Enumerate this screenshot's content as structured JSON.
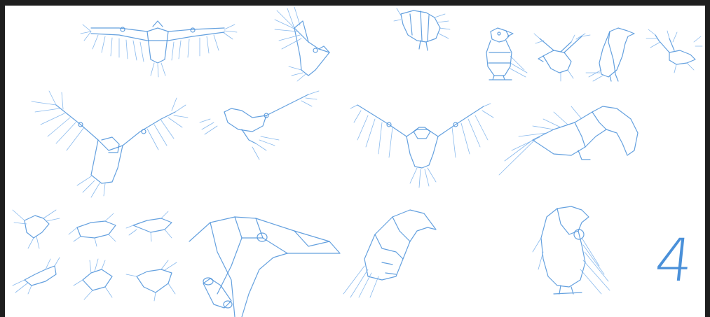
{
  "sheet": {
    "background_color": "#ffffff",
    "frame_color": "#1e1e1e",
    "ink_color": "#4a90d9",
    "page_number": "4"
  },
  "sketches": [
    {
      "name": "bird-soaring-wide-wings",
      "pose": "soaring"
    },
    {
      "name": "bird-flapping-side",
      "pose": "flapping"
    },
    {
      "name": "bird-landing-small",
      "pose": "landing"
    },
    {
      "name": "bird-perched-front",
      "pose": "perched"
    },
    {
      "name": "bird-flapping-small",
      "pose": "flapping"
    },
    {
      "name": "bird-perched-side",
      "pose": "perched"
    },
    {
      "name": "bird-takeoff-small",
      "pose": "takeoff"
    },
    {
      "name": "bird-diving-wings-up",
      "pose": "diving"
    },
    {
      "name": "bird-gliding-side",
      "pose": "gliding"
    },
    {
      "name": "bird-front-wings-spread",
      "pose": "spread"
    },
    {
      "name": "bird-swooping-folded",
      "pose": "swooping"
    },
    {
      "name": "bird-thumbnail-grid",
      "pose": "thumbnails"
    },
    {
      "name": "bird-head-closeup",
      "pose": "head"
    },
    {
      "name": "bird-perched-leaning",
      "pose": "perched"
    },
    {
      "name": "bird-perched-back",
      "pose": "perched"
    }
  ]
}
